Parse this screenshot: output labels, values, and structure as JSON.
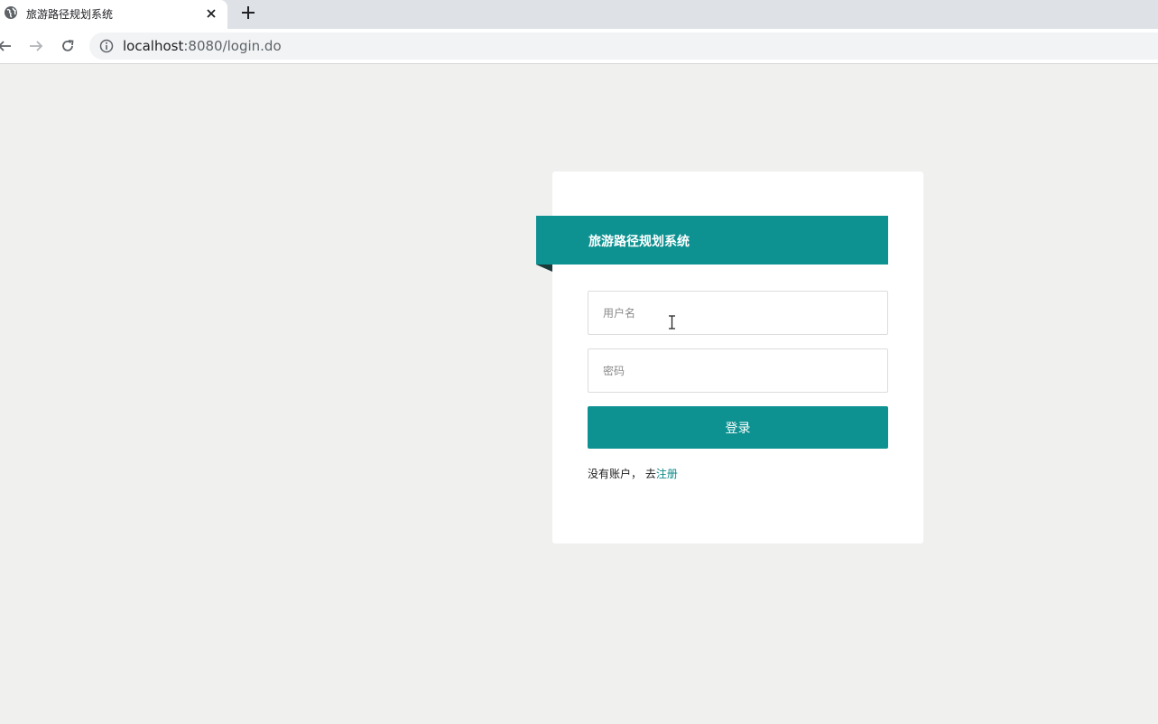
{
  "browser": {
    "tab": {
      "title": "旅游路径规划系统",
      "favicon": "globe-icon",
      "close_icon": "close-icon"
    },
    "new_tab_icon": "plus-icon",
    "nav": {
      "back_icon": "arrow-left-icon",
      "forward_icon": "arrow-right-icon",
      "reload_icon": "reload-icon"
    },
    "address": {
      "info_icon": "info-icon",
      "host": "localhost",
      "path": ":8080/login.do"
    }
  },
  "login": {
    "banner_title": "旅游路径规划系统",
    "username_placeholder": "用户名",
    "password_placeholder": "密码",
    "submit_label": "登录",
    "no_account_text": "没有账户， 去",
    "register_link": "注册"
  },
  "colors": {
    "accent": "#0e9191",
    "page_bg": "#f0f0ef",
    "card_bg": "#ffffff"
  }
}
